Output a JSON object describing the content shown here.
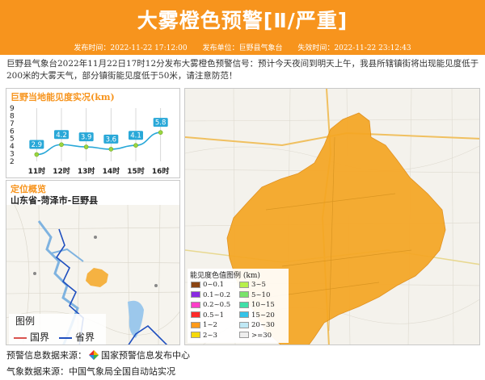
{
  "header": {
    "title": "大雾橙色预警[Ⅱ/严重]",
    "issue_time": "发布时间：2022-11-22 17:12:00",
    "issuer": "发布单位：巨野县气象台",
    "expire_time": "失效时间：2022-11-22 23:12:43"
  },
  "description": "巨野县气象台2022年11月22日17时12分发布大雾橙色预警信号：预计今天夜间到明天上午，我县所辖镇街将出现能见度低于200米的大雾天气，部分镇街能见度低于50米，请注意防范！",
  "visibility": {
    "title": "巨野当地能见度实况(km)",
    "y_ticks": [
      "9",
      "8",
      "7",
      "6",
      "5",
      "4",
      "3",
      "2"
    ],
    "chart_data": {
      "type": "line",
      "x": [
        "11时",
        "12时",
        "13时",
        "14时",
        "15时",
        "16时"
      ],
      "series": [
        {
          "values": [
            2.9,
            4.2,
            3.9,
            3.6,
            4.1,
            5.8
          ]
        }
      ],
      "ylim": [
        2,
        9
      ]
    }
  },
  "location": {
    "title": "定位概览",
    "name": "山东省-菏泽市-巨野县",
    "legend_title": "图例",
    "legend_items": [
      {
        "label": "国界",
        "color": "#d9534f"
      },
      {
        "label": "省界",
        "color": "#1f4fbf"
      }
    ]
  },
  "map_legend": {
    "title": "能见度色值图例 (km)",
    "items": [
      {
        "label": "0~0.1",
        "color": "#8b4513"
      },
      {
        "label": "3~5",
        "color": "#b7f04a"
      },
      {
        "label": "0.1~0.2",
        "color": "#8a2be2"
      },
      {
        "label": "5~10",
        "color": "#79e36a"
      },
      {
        "label": "0.2~0.5",
        "color": "#ff3ec8"
      },
      {
        "label": "10~15",
        "color": "#3fe0a8"
      },
      {
        "label": "0.5~1",
        "color": "#ff2a2a"
      },
      {
        "label": "15~20",
        "color": "#34c3e8"
      },
      {
        "label": "1~2",
        "color": "#ff9a1a"
      },
      {
        "label": "20~30",
        "color": "#bfe8f5"
      },
      {
        "label": "2~3",
        "color": "#f5d90a"
      },
      {
        "label": ">=30",
        "color": "#eeeeee"
      }
    ]
  },
  "footer": {
    "warning_source": "预警信息数据来源：",
    "warning_source_name": "国家预警信息发布中心",
    "weather_source": "气象数据来源：中国气象局全国自动站实况"
  },
  "colors": {
    "accent": "#f7941d",
    "fog_area": "#f5a623",
    "line": "#29a8d8",
    "label_bg": "#29a8d8"
  }
}
